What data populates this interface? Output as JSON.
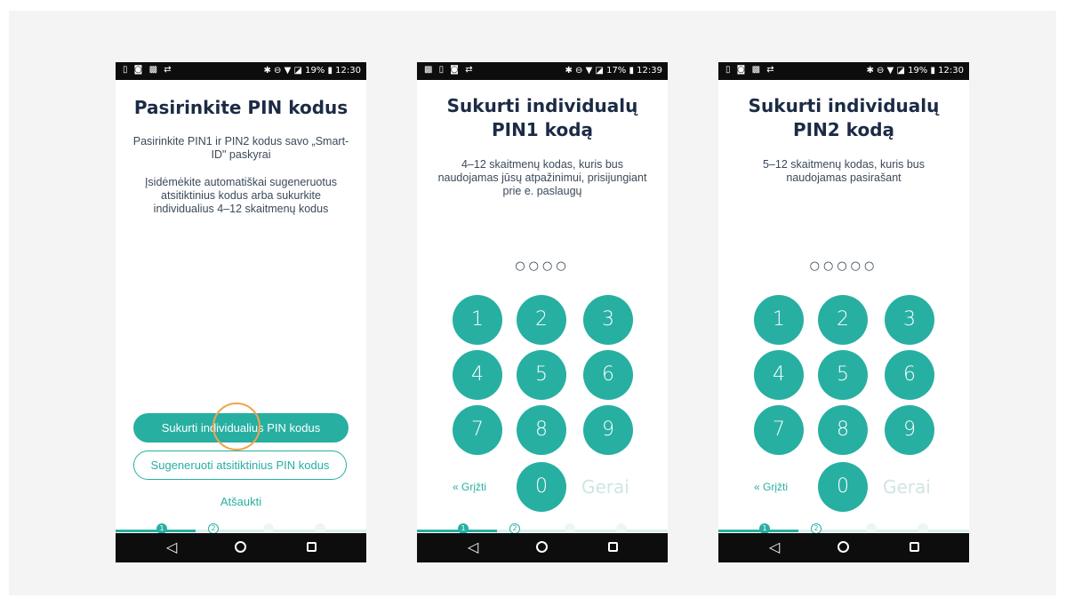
{
  "screens": [
    {
      "status_left": "▯ ◙ ▩ ⇄",
      "status_right": "✱ ⊖ ▼ ◪ 19% ▮ 12:30",
      "title": "Pasirinkite PIN kodus",
      "desc1": "Pasirinkite PIN1 ir PIN2 kodus savo „Smart-ID\" paskyrai",
      "desc2": "Įsidėmėkite automatiškai sugeneruotus atsitiktinius kodus arba sukurkite individualius 4–12 skaitmenų kodus",
      "primary_button": "Sukurti individualius PIN kodus",
      "secondary_button": "Sugeneruoti atsitiktinius PIN kodus",
      "cancel_link": "Atšaukti",
      "step1": "1",
      "step2": "2"
    },
    {
      "status_left": "▩ ▯ ◙ ⇄",
      "status_right": "✱ ⊖ ▼ ◪ 17% ▮ 12:39",
      "title": "Sukurti individualų PIN1 kodą",
      "desc": "4–12 skaitmenų kodas, kuris bus naudojamas jūsų atpažinimui, prisijungiant prie e. paslaugų",
      "pin_dots": "○○○○",
      "keys": [
        "1",
        "2",
        "3",
        "4",
        "5",
        "6",
        "7",
        "8",
        "9",
        "0"
      ],
      "back_label": "« Grįžti",
      "ok_label": "Gerai",
      "step1": "1",
      "step2": "2"
    },
    {
      "status_left": "▯ ◙ ▩ ⇄",
      "status_right": "✱ ⊖ ▼ ◪ 19% ▮ 12:30",
      "title": "Sukurti individualų PIN2 kodą",
      "desc": "5–12 skaitmenų kodas, kuris bus naudojamas pasirašant",
      "pin_dots": "○○○○○",
      "keys": [
        "1",
        "2",
        "3",
        "4",
        "5",
        "6",
        "7",
        "8",
        "9",
        "0"
      ],
      "back_label": "« Grįžti",
      "ok_label": "Gerai",
      "step1": "1",
      "step2": "2"
    }
  ],
  "nav": {
    "back_icon": "◁",
    "home_icon": "circle",
    "recents_icon": "square"
  },
  "colors": {
    "accent": "#27afa2",
    "title": "#1c2b45",
    "highlight_ring": "#f0a44a"
  }
}
